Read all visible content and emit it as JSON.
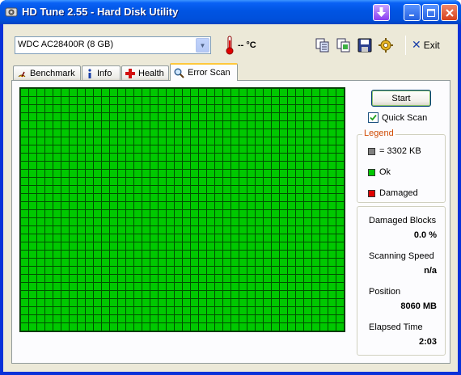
{
  "window": {
    "title": "HD Tune 2.55 - Hard Disk Utility"
  },
  "toolbar": {
    "drive": "WDC AC28400R (8 GB)",
    "temperature": "-- °C",
    "exit_label": "Exit",
    "exit_hotkey_hint": "x",
    "icons": [
      "copy-info-icon",
      "copy-screenshot-icon",
      "save-icon",
      "options-icon",
      "exit-icon"
    ]
  },
  "tabs": [
    {
      "label": "Benchmark",
      "icon": "benchmark-icon"
    },
    {
      "label": "Info",
      "icon": "info-icon"
    },
    {
      "label": "Health",
      "icon": "health-icon"
    },
    {
      "label": "Error Scan",
      "icon": "magnifier-icon",
      "active": true
    }
  ],
  "scan": {
    "start_label": "Start",
    "quick_scan_label": "Quick Scan",
    "quick_scan_checked": true,
    "block_state": "Ok",
    "block_color": "#00c800"
  },
  "legend": {
    "title": "Legend",
    "items": [
      {
        "label": "= 3302 KB",
        "color": "#808080"
      },
      {
        "label": "Ok",
        "color": "#00c800"
      },
      {
        "label": "Damaged",
        "color": "#e00000"
      }
    ]
  },
  "stats": {
    "damaged_blocks_label": "Damaged Blocks",
    "damaged_blocks_value": "0.0 %",
    "scanning_speed_label": "Scanning Speed",
    "scanning_speed_value": "n/a",
    "position_label": "Position",
    "position_value": "8060 MB",
    "elapsed_label": "Elapsed Time",
    "elapsed_value": "2:03"
  },
  "colors": {
    "titlebar": "#0054e3",
    "window_bg": "#ece9d8",
    "legend_title": "#d04a02"
  }
}
